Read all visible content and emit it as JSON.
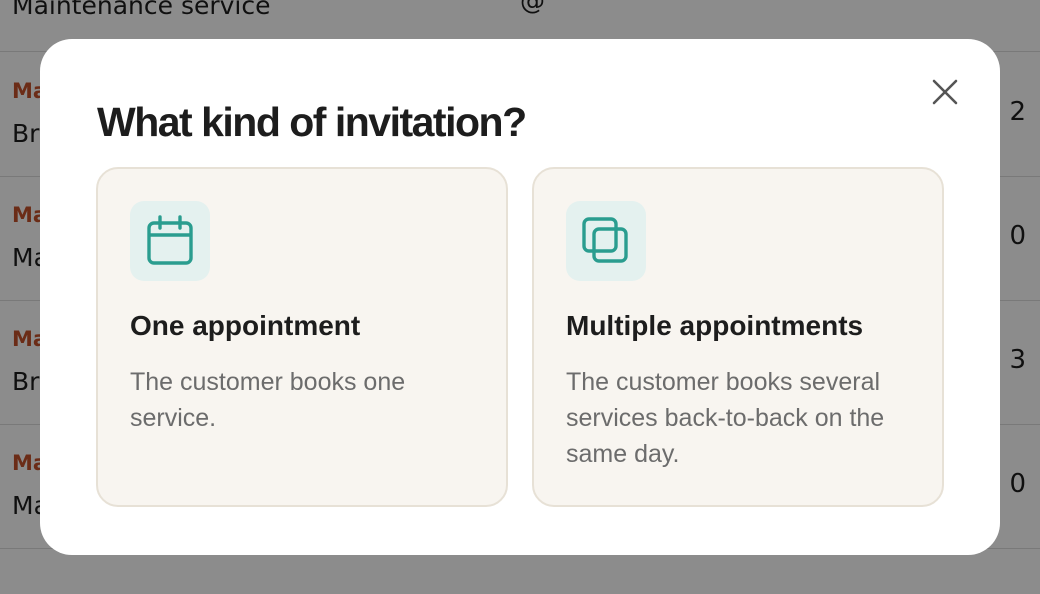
{
  "background": {
    "top_row": {
      "title": "Maintenance service",
      "fragment": "@"
    },
    "rows": [
      {
        "category": "Ma",
        "name": "Br",
        "count": "2"
      },
      {
        "category": "Ma",
        "name": "Ma",
        "count": "0"
      },
      {
        "category": "Ma",
        "name": "Br",
        "count": "3"
      },
      {
        "category": "Ma",
        "name": "Ma",
        "count": "0"
      }
    ]
  },
  "modal": {
    "title": "What kind of invitation?",
    "close_icon": "close-icon",
    "options": [
      {
        "icon": "calendar-icon",
        "title": "One appointment",
        "description": "The customer books one service."
      },
      {
        "icon": "stacked-squares-icon",
        "title": "Multiple appointments",
        "description": "The customer books several services back-to-back on the same day."
      }
    ]
  },
  "colors": {
    "accent": "#2a9d8f",
    "icon_bg": "#e4f1ef",
    "card_bg": "#f8f5f0",
    "category_text": "#c4512a"
  }
}
